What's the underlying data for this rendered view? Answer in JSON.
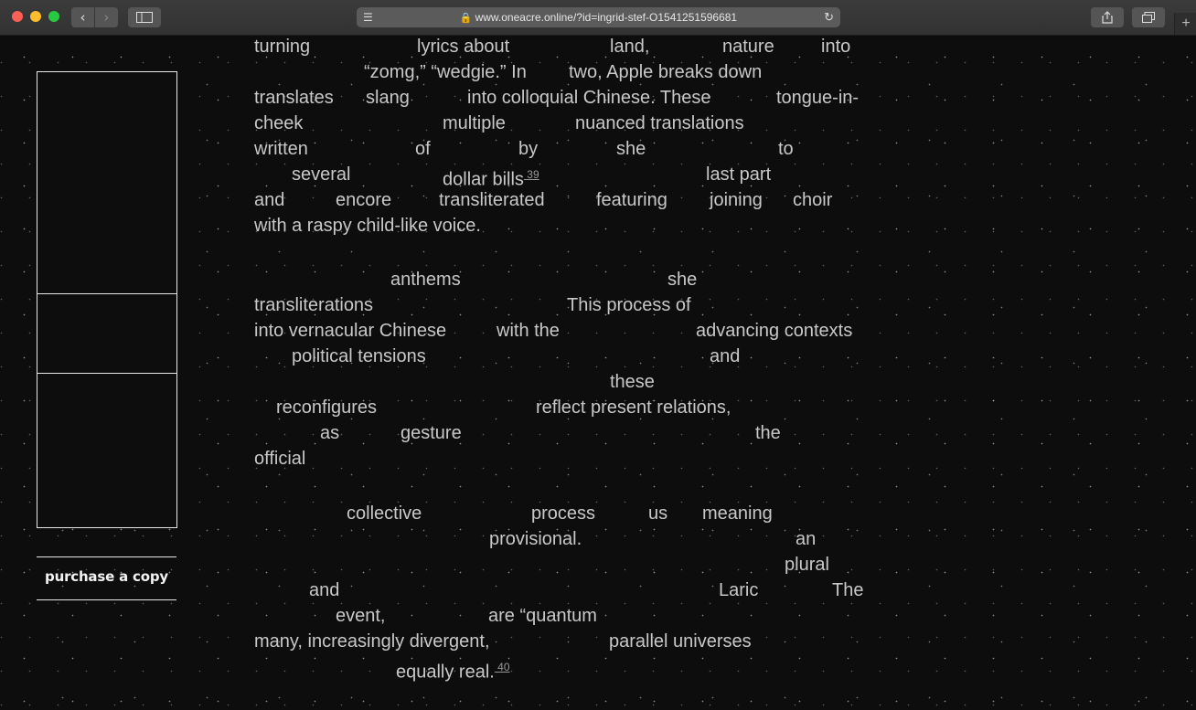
{
  "browser": {
    "url": "www.oneacre.online/?id=ingrid-stef-O1541251596681",
    "icons": {
      "back": "chevron-left-icon",
      "forward": "chevron-right-icon",
      "sidebar": "sidebar-icon",
      "reader": "reader-icon",
      "lock": "lock-icon",
      "reload": "reload-icon",
      "share": "share-icon",
      "tabs": "tabs-icon",
      "new_tab": "plus-icon"
    }
  },
  "sidebar": {
    "purchase_label": "purchase a copy"
  },
  "text": {
    "words": [
      {
        "t": "turning"
      },
      {
        "t": "lyrics about"
      },
      {
        "t": "land,"
      },
      {
        "t": "nature"
      },
      {
        "t": "into"
      },
      {
        "t": "“zomg,” “wedgie.” In"
      },
      {
        "t": "two, Apple breaks down"
      },
      {
        "t": "translates"
      },
      {
        "t": "slang"
      },
      {
        "t": "into colloquial Chinese. These"
      },
      {
        "t": "tongue-in-"
      },
      {
        "t": "cheek"
      },
      {
        "t": "multiple"
      },
      {
        "t": "nuanced translations"
      },
      {
        "t": "written"
      },
      {
        "t": "of"
      },
      {
        "t": "by"
      },
      {
        "t": "she"
      },
      {
        "t": "to"
      },
      {
        "t": "several"
      },
      {
        "t": "dollar bills"
      },
      {
        "t": "last part"
      },
      {
        "t": "and"
      },
      {
        "t": "encore"
      },
      {
        "t": "transliterated"
      },
      {
        "t": "featuring"
      },
      {
        "t": "joining"
      },
      {
        "t": "choir"
      },
      {
        "t": "with a raspy child-like voice."
      },
      {
        "t": "anthems"
      },
      {
        "t": "she"
      },
      {
        "t": "transliterations"
      },
      {
        "t": "This process of"
      },
      {
        "t": "into vernacular Chinese"
      },
      {
        "t": "with the"
      },
      {
        "t": "advancing contexts"
      },
      {
        "t": "political tensions"
      },
      {
        "t": "and"
      },
      {
        "t": "these"
      },
      {
        "t": "reconfigures"
      },
      {
        "t": "reflect present relations,"
      },
      {
        "t": "as"
      },
      {
        "t": "gesture"
      },
      {
        "t": "the"
      },
      {
        "t": "official"
      },
      {
        "t": "collective"
      },
      {
        "t": "process"
      },
      {
        "t": "us"
      },
      {
        "t": "meaning"
      },
      {
        "t": "provisional."
      },
      {
        "t": "an"
      },
      {
        "t": "plural"
      },
      {
        "t": "and"
      },
      {
        "t": "Laric"
      },
      {
        "t": "The"
      },
      {
        "t": "event,"
      },
      {
        "t": "are “quantum"
      },
      {
        "t": "many, increasingly divergent,"
      },
      {
        "t": "parallel universes"
      },
      {
        "t": "equally real."
      }
    ],
    "footnotes": [
      "39",
      "40"
    ]
  }
}
